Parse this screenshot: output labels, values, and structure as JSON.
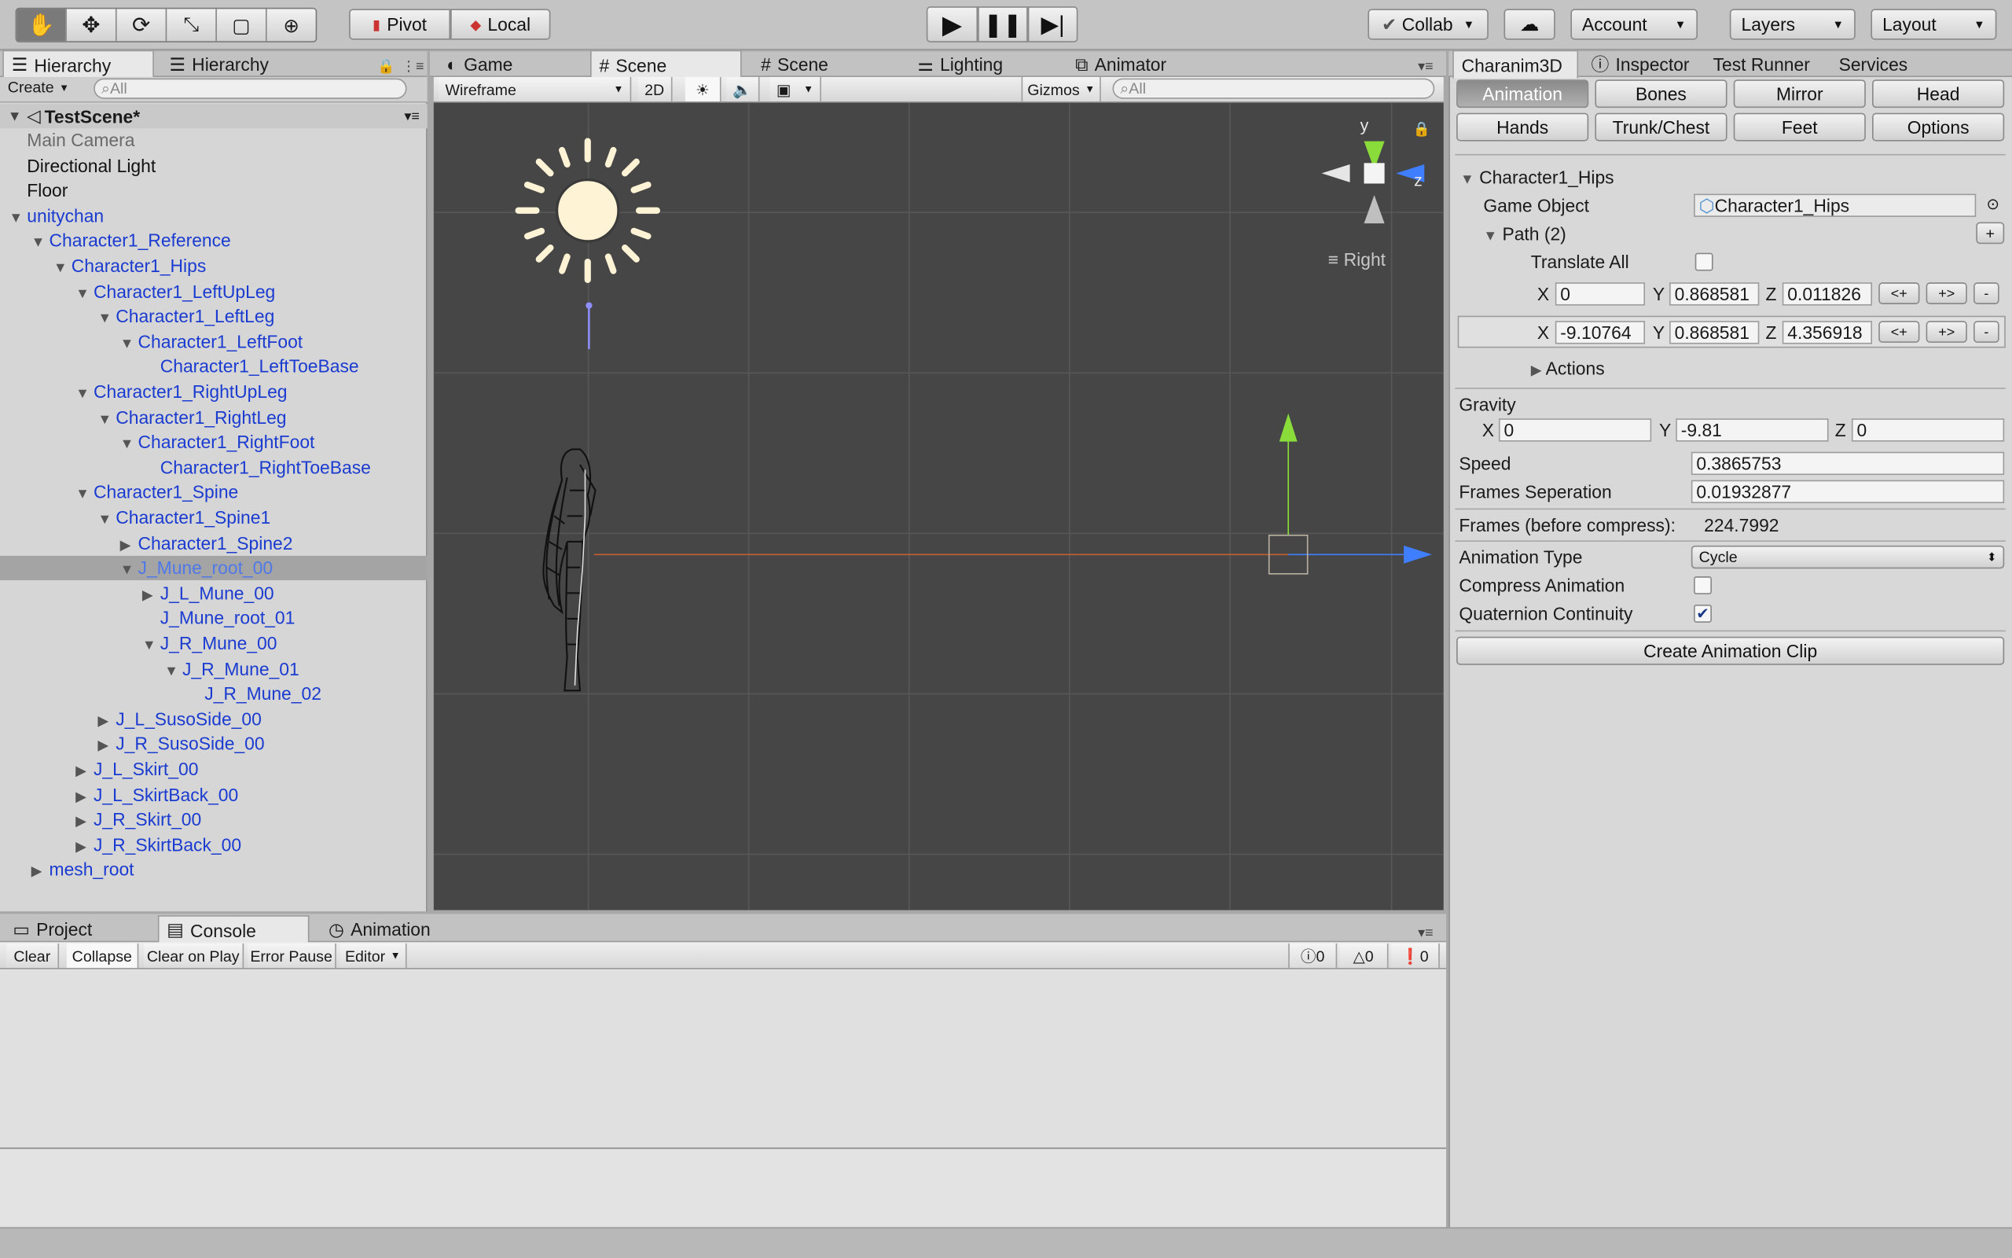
{
  "toolbar": {
    "pivot": "Pivot",
    "local": "Local",
    "collab": "Collab",
    "account": "Account",
    "layers": "Layers",
    "layout": "Layout"
  },
  "hierarchy": {
    "tabs": [
      "Hierarchy",
      "Hierarchy"
    ],
    "create": "Create",
    "search_placeholder": "All",
    "scene": "TestScene*",
    "items": [
      {
        "label": "Main Camera",
        "depth": 1,
        "arrow": "",
        "style": "grey"
      },
      {
        "label": "Directional Light",
        "depth": 1,
        "arrow": "",
        "style": "plain"
      },
      {
        "label": "Floor",
        "depth": 1,
        "arrow": "",
        "style": "plain"
      },
      {
        "label": "unitychan",
        "depth": 1,
        "arrow": "down",
        "style": "blue"
      },
      {
        "label": "Character1_Reference",
        "depth": 2,
        "arrow": "down",
        "style": "blue"
      },
      {
        "label": "Character1_Hips",
        "depth": 3,
        "arrow": "down",
        "style": "blue"
      },
      {
        "label": "Character1_LeftUpLeg",
        "depth": 4,
        "arrow": "down",
        "style": "blue"
      },
      {
        "label": "Character1_LeftLeg",
        "depth": 5,
        "arrow": "down",
        "style": "blue"
      },
      {
        "label": "Character1_LeftFoot",
        "depth": 6,
        "arrow": "down",
        "style": "blue"
      },
      {
        "label": "Character1_LeftToeBase",
        "depth": 7,
        "arrow": "",
        "style": "blue"
      },
      {
        "label": "Character1_RightUpLeg",
        "depth": 4,
        "arrow": "down",
        "style": "blue"
      },
      {
        "label": "Character1_RightLeg",
        "depth": 5,
        "arrow": "down",
        "style": "blue"
      },
      {
        "label": "Character1_RightFoot",
        "depth": 6,
        "arrow": "down",
        "style": "blue"
      },
      {
        "label": "Character1_RightToeBase",
        "depth": 7,
        "arrow": "",
        "style": "blue"
      },
      {
        "label": "Character1_Spine",
        "depth": 4,
        "arrow": "down",
        "style": "blue"
      },
      {
        "label": "Character1_Spine1",
        "depth": 5,
        "arrow": "down",
        "style": "blue"
      },
      {
        "label": "Character1_Spine2",
        "depth": 6,
        "arrow": "right",
        "style": "blue"
      },
      {
        "label": "J_Mune_root_00",
        "depth": 6,
        "arrow": "down",
        "style": "selected"
      },
      {
        "label": "J_L_Mune_00",
        "depth": 7,
        "arrow": "right",
        "style": "blue"
      },
      {
        "label": "J_Mune_root_01",
        "depth": 7,
        "arrow": "",
        "style": "blue"
      },
      {
        "label": "J_R_Mune_00",
        "depth": 7,
        "arrow": "down",
        "style": "blue"
      },
      {
        "label": "J_R_Mune_01",
        "depth": 8,
        "arrow": "down",
        "style": "blue"
      },
      {
        "label": "J_R_Mune_02",
        "depth": 9,
        "arrow": "",
        "style": "blue"
      },
      {
        "label": "J_L_SusoSide_00",
        "depth": 5,
        "arrow": "right",
        "style": "blue"
      },
      {
        "label": "J_R_SusoSide_00",
        "depth": 5,
        "arrow": "right",
        "style": "blue"
      },
      {
        "label": "J_L_Skirt_00",
        "depth": 4,
        "arrow": "right",
        "style": "blue"
      },
      {
        "label": "J_L_SkirtBack_00",
        "depth": 4,
        "arrow": "right",
        "style": "blue"
      },
      {
        "label": "J_R_Skirt_00",
        "depth": 4,
        "arrow": "right",
        "style": "blue"
      },
      {
        "label": "J_R_SkirtBack_00",
        "depth": 4,
        "arrow": "right",
        "style": "blue"
      },
      {
        "label": "mesh_root",
        "depth": 2,
        "arrow": "right",
        "style": "blue"
      }
    ]
  },
  "scene": {
    "tabs": [
      "Game",
      "Scene",
      "Scene",
      "Lighting",
      "Animator"
    ],
    "shading": "Wireframe",
    "mode2d": "2D",
    "gizmos": "Gizmos",
    "search_placeholder": "All",
    "gizmo": {
      "y": "y",
      "z": "z",
      "view": "Right"
    }
  },
  "console": {
    "tabs": [
      "Project",
      "Console",
      "Animation"
    ],
    "buttons": [
      "Clear",
      "Collapse",
      "Clear on Play",
      "Error Pause",
      "Editor"
    ],
    "counts": {
      "info": "0",
      "warn": "0",
      "error": "0"
    }
  },
  "inspector": {
    "tabs": [
      "Charanim3D",
      "Inspector",
      "Test Runner",
      "Services"
    ],
    "buttons_row1": [
      "Animation",
      "Bones",
      "Mirror",
      "Head"
    ],
    "buttons_row2": [
      "Hands",
      "Trunk/Chest",
      "Feet",
      "Options"
    ],
    "root_label": "Character1_Hips",
    "game_object_label": "Game Object",
    "game_object_value": "Character1_Hips",
    "path_label": "Path (2)",
    "translate_all": "Translate All",
    "row1": {
      "x_label": "X",
      "x": "0",
      "y_label": "Y",
      "y": "0.868581",
      "z_label": "Z",
      "z": "0.011826"
    },
    "row2": {
      "x_label": "X",
      "x": "-9.10764",
      "y_label": "Y",
      "y": "0.868581",
      "z_label": "Z",
      "z": "4.356918"
    },
    "row_buttons": [
      "<+",
      "+>",
      "-"
    ],
    "plus": "+",
    "actions": "Actions",
    "gravity": "Gravity",
    "gravity_vals": {
      "x_label": "X",
      "x": "0",
      "y_label": "Y",
      "y": "-9.81",
      "z_label": "Z",
      "z": "0"
    },
    "speed_label": "Speed",
    "speed": "0.3865753",
    "frames_sep_label": "Frames Seperation",
    "frames_sep": "0.01932877",
    "frames_before_label": "Frames (before compress):",
    "frames_before": "224.7992",
    "anim_type_label": "Animation Type",
    "anim_type": "Cycle",
    "compress_label": "Compress Animation",
    "quat_label": "Quaternion Continuity",
    "create_clip": "Create Animation Clip"
  }
}
